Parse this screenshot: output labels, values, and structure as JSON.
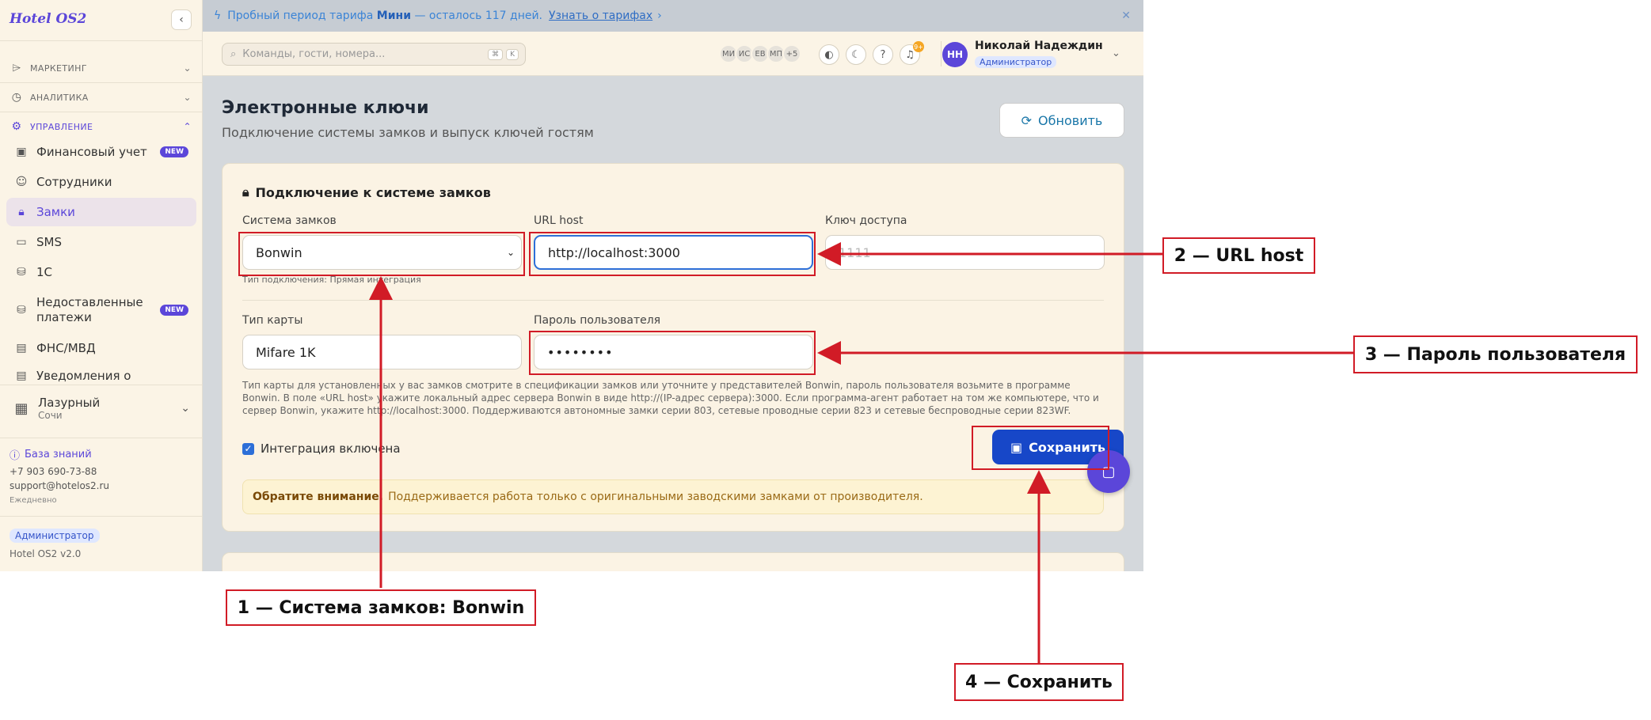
{
  "app": {
    "logo": "Hotel OS2",
    "version": "Hotel OS2 v2.0"
  },
  "sidebar": {
    "sections": [
      {
        "label": "МАРКЕТИНГ"
      },
      {
        "label": "АНАЛИТИКА"
      },
      {
        "label": "УПРАВЛЕНИЕ"
      }
    ],
    "items": [
      {
        "label": "Финансовый учет",
        "badge": "NEW"
      },
      {
        "label": "Сотрудники"
      },
      {
        "label": "Замки"
      },
      {
        "label": "SMS"
      },
      {
        "label": "1С"
      },
      {
        "label": "Недоставленные платежи",
        "badge": "NEW"
      },
      {
        "label": "ФНС/МВД"
      },
      {
        "label": "Уведомления о"
      }
    ],
    "hotel": {
      "name": "Лазурный",
      "city": "Сочи"
    },
    "knowledge_base": "База знаний",
    "phone": "+7 903 690-73-88",
    "email": "support@hotelos2.ru",
    "schedule": "Ежедневно",
    "role": "Администратор"
  },
  "banner": {
    "prefix": "Пробный период тарифа",
    "plan": "Мини",
    "suffix": "— осталось 117 дней.",
    "link": "Узнать о тарифах",
    "link_arrow": "›"
  },
  "topbar": {
    "search_placeholder": "Команды, гости, номера...",
    "kbd1": "⌘",
    "kbd2": "K",
    "avatars": [
      "МИ",
      "ИС",
      "ЕВ",
      "МП",
      "+5"
    ],
    "notif_count": "9+",
    "user_initials": "НН",
    "user_name": "Николай Надеждин",
    "user_role": "Администратор"
  },
  "page": {
    "title": "Электронные ключи",
    "subtitle": "Подключение системы замков и выпуск ключей гостям",
    "refresh": "Обновить"
  },
  "form": {
    "card_title": "Подключение к системе замков",
    "lock_system_label": "Система замков",
    "lock_system_value": "Bonwin",
    "connection_hint": "Тип подключения: Прямая интеграция",
    "url_label": "URL host",
    "url_value": "http://localhost:3000",
    "key_label": "Ключ доступа",
    "key_placeholder": "1111",
    "card_type_label": "Тип карты",
    "card_type_value": "Mifare 1K",
    "password_label": "Пароль пользователя",
    "password_value": "••••••••",
    "long_hint": "Тип карты для установленных у вас замков смотрите в спецификации замков или уточните у представителей Bonwin, пароль пользователя возьмите в программе Bonwin. В поле «URL host» укажите локальный адрес сервера Bonwin в виде http://(IP-адрес сервера):3000. Если программа-агент работает на том же компьютере, что и сервер Bonwin, укажите http://localhost:3000. Поддерживаются автономные замки серии 803, сетевые проводные серии 823 и сетевые беспроводные серии 823WF.",
    "integration_label": "Интеграция включена",
    "integration_enabled": true,
    "save": "Сохранить",
    "notice_bold": "Обратите внимание.",
    "notice_text": "Поддерживается работа только с оригинальными заводскими замками от производителя."
  },
  "annotations": {
    "a1": "1 — Система замков: Bonwin",
    "a2": "2 — URL host",
    "a3": "3 — Пароль пользователя",
    "a4": "4 — Сохранить"
  },
  "colors": {
    "accent": "#5b46d9",
    "primary_button": "#1747c8",
    "annotation": "#d11b26"
  }
}
